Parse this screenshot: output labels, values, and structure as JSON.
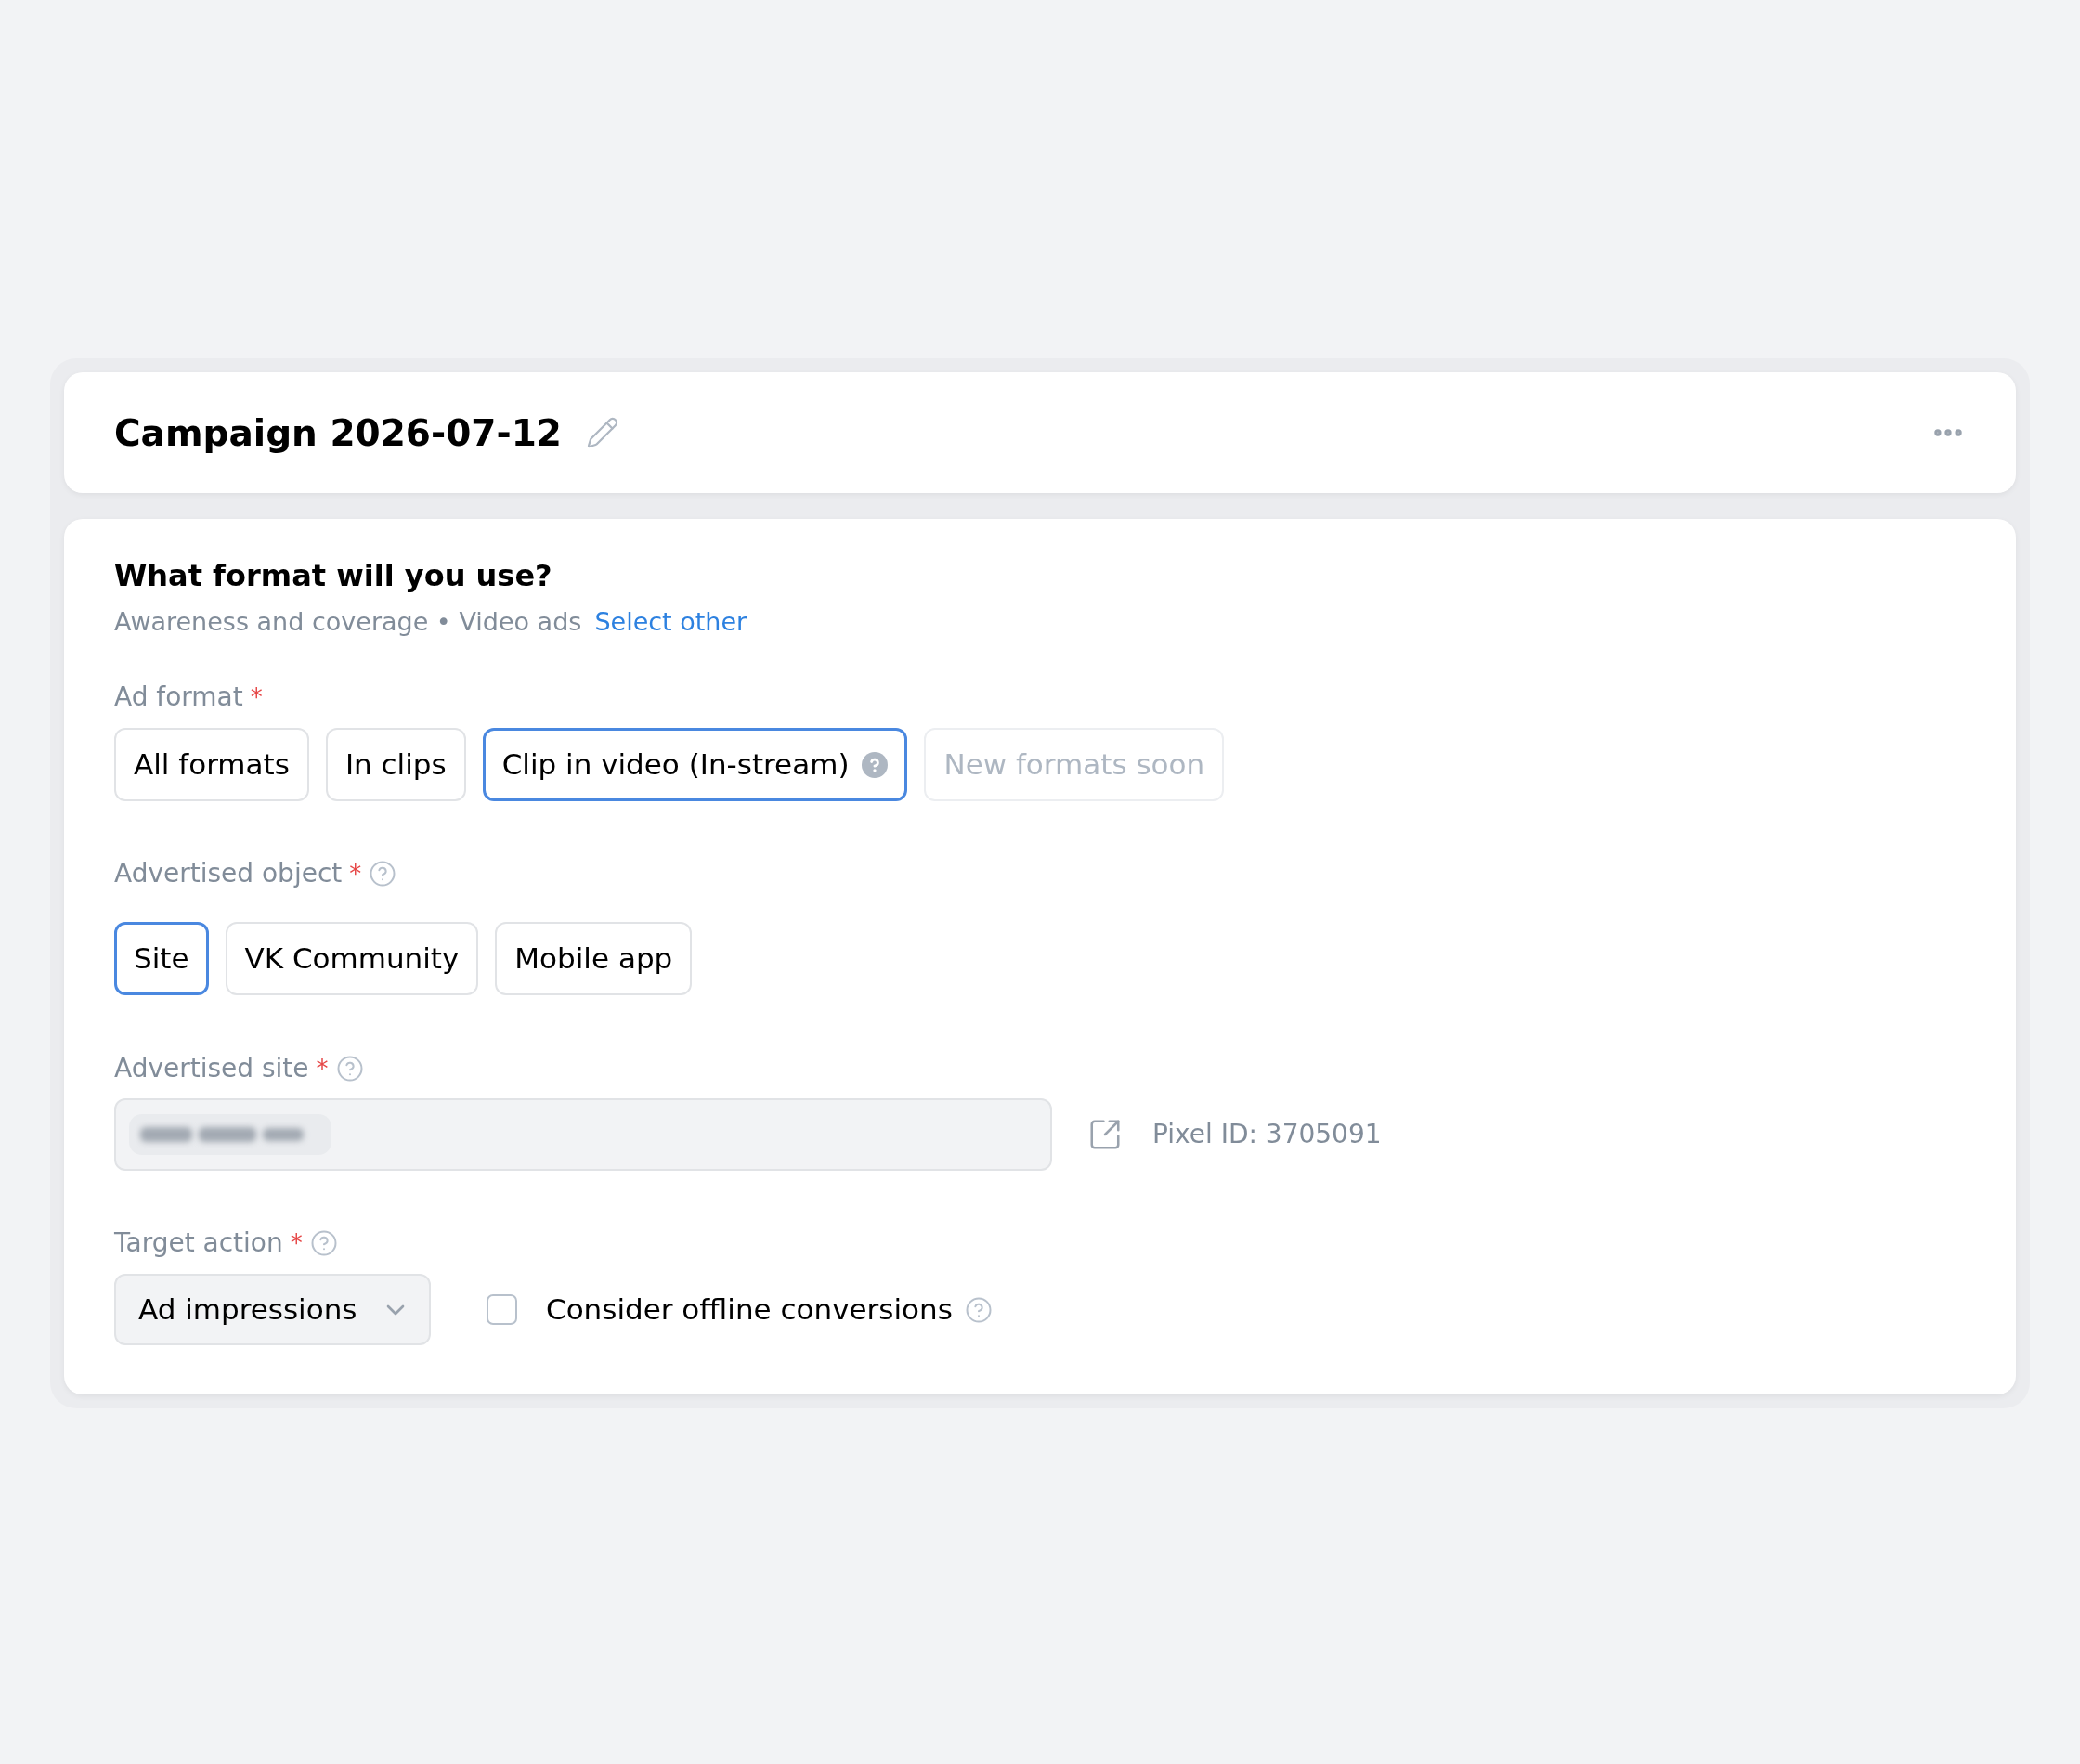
{
  "header": {
    "title": "Campaign 2026-07-12"
  },
  "format": {
    "heading": "What format will you use?",
    "subtitle": "Awareness and coverage • Video ads",
    "link": "Select other"
  },
  "ad_format": {
    "label": "Ad format",
    "required_mark": "*",
    "help": false,
    "options": [
      {
        "label": "All formats",
        "selected": false,
        "disabled": false,
        "help": false
      },
      {
        "label": "In clips",
        "selected": false,
        "disabled": false,
        "help": false
      },
      {
        "label": "Clip in video (In-stream)",
        "selected": true,
        "disabled": false,
        "help": true
      },
      {
        "label": "New formats soon",
        "selected": false,
        "disabled": true,
        "help": false
      }
    ]
  },
  "advertised_object": {
    "label": "Advertised object",
    "required_mark": "*",
    "help": true,
    "options": [
      {
        "label": "Site",
        "selected": true
      },
      {
        "label": "VK Community",
        "selected": false
      },
      {
        "label": "Mobile app",
        "selected": false
      }
    ]
  },
  "advertised_site": {
    "label": "Advertised site",
    "required_mark": "*",
    "help": true,
    "redacted": true,
    "pixel_id": "Pixel ID: 3705091"
  },
  "target_action": {
    "label": "Target action",
    "required_mark": "*",
    "help": true,
    "value": "Ad impressions",
    "checkbox": {
      "label": "Consider offline conversions",
      "checked": false,
      "help": true
    }
  }
}
